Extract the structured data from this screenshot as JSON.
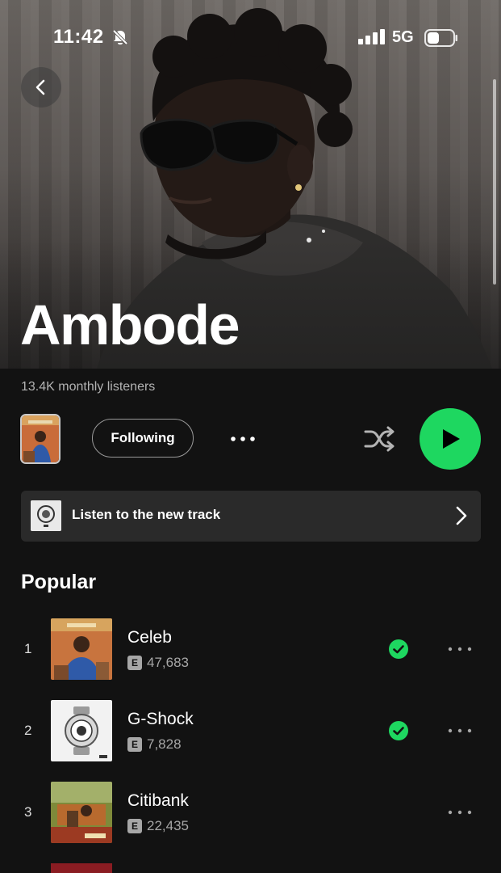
{
  "status_bar": {
    "time": "11:42",
    "network": "5G"
  },
  "artist": {
    "name": "Ambode",
    "monthly_listeners": "13.4K monthly listeners"
  },
  "actions": {
    "follow_label": "Following"
  },
  "promo": {
    "label": "Listen to the new track"
  },
  "popular": {
    "title": "Popular",
    "tracks": [
      {
        "rank": "1",
        "title": "Celeb",
        "plays": "47,683",
        "explicit": "E",
        "saved": true
      },
      {
        "rank": "2",
        "title": "G-Shock",
        "plays": "7,828",
        "explicit": "E",
        "saved": true
      },
      {
        "rank": "3",
        "title": "Citibank",
        "plays": "22,435",
        "explicit": "E",
        "saved": false
      }
    ]
  },
  "colors": {
    "accent": "#1ed760",
    "background": "#121212",
    "secondary_text": "#b3b3b3"
  },
  "icons": [
    "bell-slash-icon",
    "signal-icon",
    "battery-icon",
    "back-chevron-icon",
    "shuffle-icon",
    "play-icon",
    "more-icon",
    "chevron-right-icon",
    "check-circle-icon",
    "explicit-badge"
  ]
}
